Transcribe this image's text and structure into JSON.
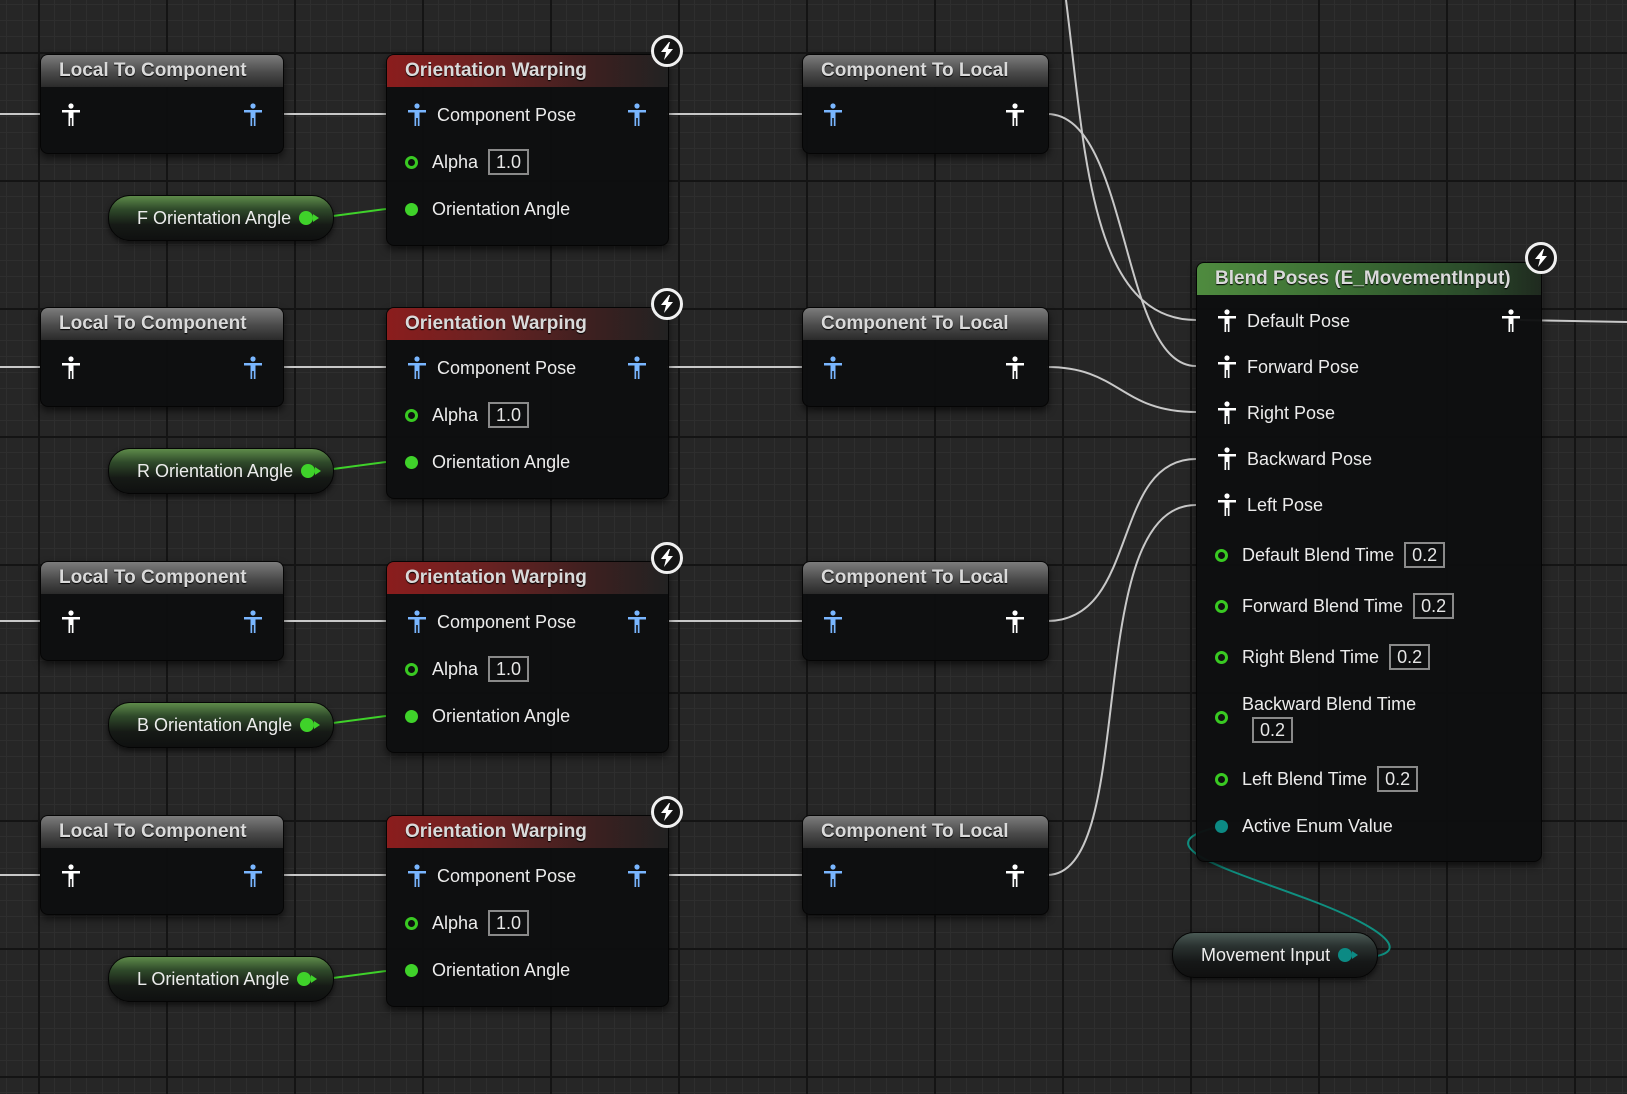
{
  "rows": [
    {
      "local_to_component": {
        "title": "Local To Component"
      },
      "orientation_warping": {
        "title": "Orientation Warping",
        "component_pose_label": "Component Pose",
        "alpha_label": "Alpha",
        "alpha_value": "1.0",
        "orientation_angle_label": "Orientation Angle"
      },
      "component_to_local": {
        "title": "Component To Local"
      },
      "angle_variable": {
        "label": "F Orientation Angle"
      }
    },
    {
      "local_to_component": {
        "title": "Local To Component"
      },
      "orientation_warping": {
        "title": "Orientation Warping",
        "component_pose_label": "Component Pose",
        "alpha_label": "Alpha",
        "alpha_value": "1.0",
        "orientation_angle_label": "Orientation Angle"
      },
      "component_to_local": {
        "title": "Component To Local"
      },
      "angle_variable": {
        "label": "R Orientation Angle"
      }
    },
    {
      "local_to_component": {
        "title": "Local To Component"
      },
      "orientation_warping": {
        "title": "Orientation Warping",
        "component_pose_label": "Component Pose",
        "alpha_label": "Alpha",
        "alpha_value": "1.0",
        "orientation_angle_label": "Orientation Angle"
      },
      "component_to_local": {
        "title": "Component To Local"
      },
      "angle_variable": {
        "label": "B Orientation Angle"
      }
    },
    {
      "local_to_component": {
        "title": "Local To Component"
      },
      "orientation_warping": {
        "title": "Orientation Warping",
        "component_pose_label": "Component Pose",
        "alpha_label": "Alpha",
        "alpha_value": "1.0",
        "orientation_angle_label": "Orientation Angle"
      },
      "component_to_local": {
        "title": "Component To Local"
      },
      "angle_variable": {
        "label": "L Orientation Angle"
      }
    }
  ],
  "blend_poses": {
    "title": "Blend Poses (E_MovementInput)",
    "pose_inputs": [
      "Default Pose",
      "Forward Pose",
      "Right Pose",
      "Backward Pose",
      "Left Pose"
    ],
    "blend_times": [
      {
        "label": "Default Blend Time",
        "value": "0.2"
      },
      {
        "label": "Forward Blend Time",
        "value": "0.2"
      },
      {
        "label": "Right Blend Time",
        "value": "0.2"
      },
      {
        "label": "Backward Blend Time",
        "value": "0.2"
      },
      {
        "label": "Left Blend Time",
        "value": "0.2"
      }
    ],
    "active_enum_label": "Active Enum Value"
  },
  "movement_input_variable": {
    "label": "Movement Input"
  },
  "colors": {
    "background": "#262626",
    "wire_pose": "#c8c8c8",
    "wire_float": "#3fd22a",
    "wire_enum": "#0f8f80",
    "pose_pin_local": "#ffffff",
    "pose_pin_component": "#79b6ff",
    "float_pin": "#3fd22a",
    "enum_pin": "#0c8a84"
  },
  "icons": {
    "pose_pin": "person-icon",
    "fast_path": "lightning-icon",
    "float_pin": "circle-pin-icon"
  }
}
